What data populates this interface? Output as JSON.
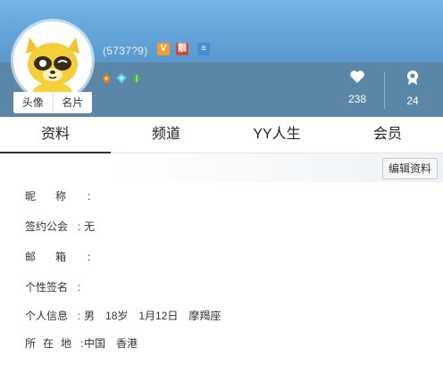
{
  "header": {
    "uid": "(5737?9)",
    "avatar_buttons": [
      "头像",
      "名片"
    ],
    "badges": [
      {
        "text": "V",
        "color": "#f0a030"
      },
      {
        "text": "靓",
        "color": "#d9452e"
      },
      {
        "text": "≡",
        "color": "#3e8fd8"
      }
    ],
    "medal_icons": [
      "wing-medal-icon",
      "diamond-medal-icon",
      "leaf-medal-icon"
    ],
    "stats": [
      {
        "icon": "heart-icon",
        "value": "238"
      },
      {
        "icon": "award-icon",
        "value": "24"
      }
    ]
  },
  "tabs": [
    "资料",
    "频道",
    "YY人生",
    "会员"
  ],
  "toolbar": {
    "edit_label": "编辑资料"
  },
  "profile": {
    "nickname": {
      "label": "昵称",
      "value": ""
    },
    "guild": {
      "label": "签约公会",
      "value": "无"
    },
    "email": {
      "label": "邮箱",
      "value": ""
    },
    "signature": {
      "label": "个性签名",
      "value": ""
    },
    "personal": {
      "label": "个人信息",
      "gender": "男",
      "age": "18岁",
      "birthday": "1月12日",
      "zodiac": "摩羯座"
    },
    "location": {
      "label": "所在地",
      "country": "中国",
      "city": "香港"
    }
  }
}
